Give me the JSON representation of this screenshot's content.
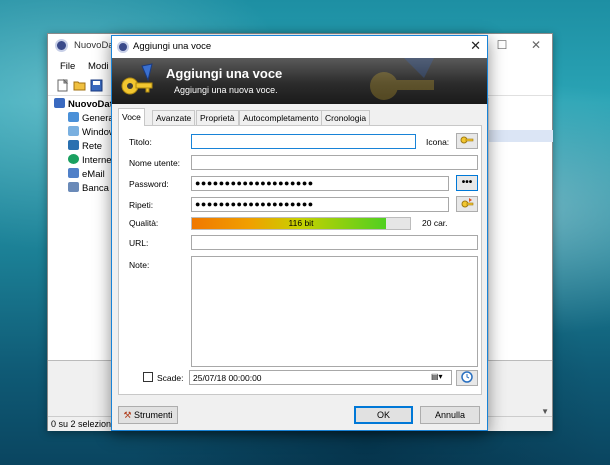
{
  "main_window": {
    "title": "NuovoDat",
    "menu": [
      "File",
      "Modi"
    ],
    "tree": [
      {
        "label": "NuovoDat",
        "icon": "database-icon",
        "bold": true
      },
      {
        "label": "Genera",
        "icon": "folder-icon"
      },
      {
        "label": "Window",
        "icon": "windows-icon"
      },
      {
        "label": "Rete",
        "icon": "network-icon"
      },
      {
        "label": "Interne",
        "icon": "globe-icon"
      },
      {
        "label": "eMail",
        "icon": "email-icon"
      },
      {
        "label": "Banca e",
        "icon": "bank-icon"
      }
    ],
    "status": "0 su 2 seleziona"
  },
  "dialog": {
    "title": "Aggiungi una voce",
    "banner_title": "Aggiungi una voce",
    "banner_subtitle": "Aggiungi una nuova voce.",
    "tabs": [
      "Voce",
      "Avanzate",
      "Proprietà",
      "Autocompletamento",
      "Cronologia"
    ],
    "active_tab": 0,
    "labels": {
      "title": "Titolo:",
      "icon": "Icona:",
      "username": "Nome utente:",
      "password": "Password:",
      "repeat": "Ripeti:",
      "quality": "Qualità:",
      "url": "URL:",
      "notes": "Note:",
      "expires": "Scade:"
    },
    "values": {
      "title": "",
      "username": "",
      "password": "●●●●●●●●●●●●●●●●●●●●",
      "repeat": "●●●●●●●●●●●●●●●●●●●●",
      "url": "",
      "notes": "",
      "expires": "25/07/18 00:00:00"
    },
    "quality": {
      "text": "116 bit",
      "fraction": 0.89,
      "chars": "20 car."
    },
    "show_password_label": "•••",
    "buttons": {
      "tools": "Strumenti",
      "ok": "OK",
      "cancel": "Annulla"
    }
  }
}
